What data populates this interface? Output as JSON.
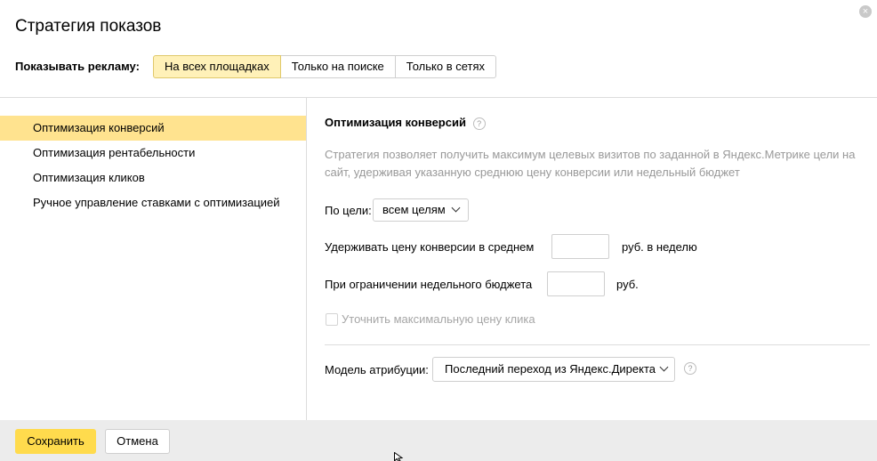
{
  "dialog": {
    "title": "Стратегия показов",
    "close_glyph": "×",
    "show_label": "Показывать рекламу:",
    "placement_tabs": [
      {
        "label": "На всех площадках",
        "active": true
      },
      {
        "label": "Только на поиске",
        "active": false
      },
      {
        "label": "Только в сетях",
        "active": false
      }
    ]
  },
  "sidebar": {
    "items": [
      {
        "label": "Оптимизация конверсий",
        "active": true
      },
      {
        "label": "Оптимизация рентабельности",
        "active": false
      },
      {
        "label": "Оптимизация кликов",
        "active": false
      },
      {
        "label": "Ручное управление ставками с оптимизацией",
        "active": false
      }
    ]
  },
  "main": {
    "section_title": "Оптимизация конверсий",
    "help_glyph": "?",
    "description_lines": [
      "Стратегия позволяет получить максимум целевых визитов по заданной в Яндекс.Метрике цели на",
      "сайт, удерживая указанную среднюю цену конверсии или недельный бюджет"
    ],
    "goal_label": "По цели:",
    "goal_value": "всем целям",
    "cpa_label": "Удерживать цену конверсии в среднем",
    "cpa_value": "",
    "cpa_unit": "руб. в неделю",
    "budget_label": "При ограничении недельного бюджета",
    "budget_value": "",
    "budget_unit": "руб.",
    "max_click_label": "Уточнить максимальную цену клика",
    "max_click_checked": false,
    "attribution_label": "Модель атрибуции:",
    "attribution_value": "Последний переход из Яндекс.Директа"
  },
  "footer": {
    "save_label": "Сохранить",
    "cancel_label": "Отмена"
  },
  "colors": {
    "active_tab": "#fff1b8",
    "active_sidebar": "#ffe38f",
    "save_button": "#ffdb4d",
    "footer_bg": "#ececec"
  }
}
